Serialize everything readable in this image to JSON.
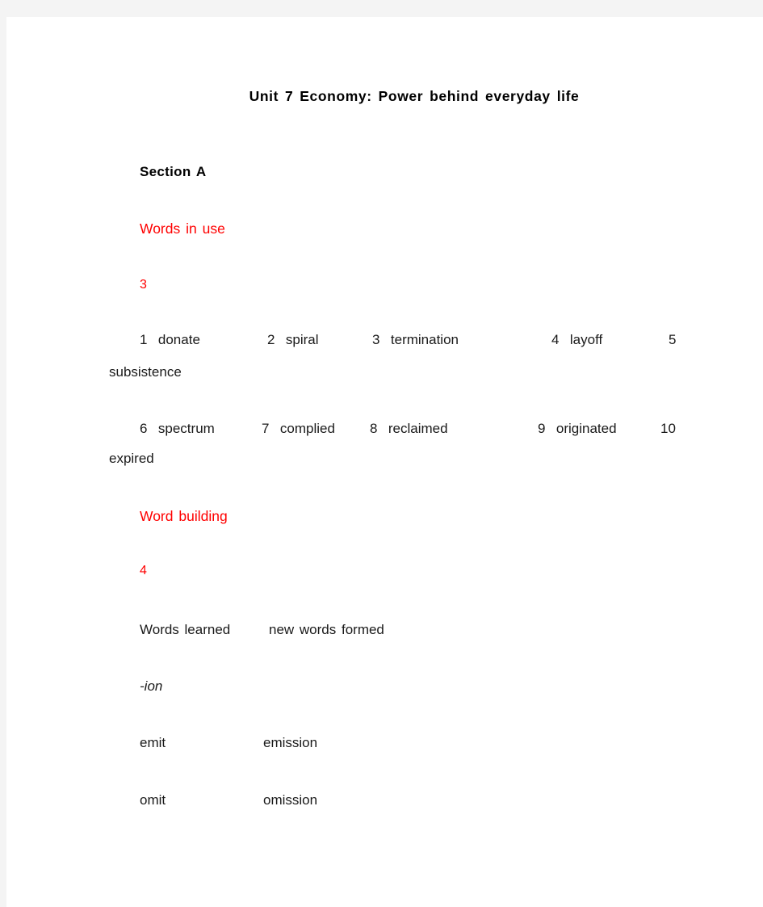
{
  "document": {
    "title": "Unit 7 Economy: Power behind everyday life",
    "section_heading": "Section A"
  },
  "words_in_use": {
    "heading": "Words in use",
    "exercise_number": "3",
    "answers": [
      {
        "number": "1",
        "word": "donate"
      },
      {
        "number": "2",
        "word": "spiral"
      },
      {
        "number": "3",
        "word": "termination"
      },
      {
        "number": "4",
        "word": "layoff"
      },
      {
        "number": "5",
        "word": "subsistence"
      },
      {
        "number": "6",
        "word": "spectrum"
      },
      {
        "number": "7",
        "word": "complied"
      },
      {
        "number": "8",
        "word": "reclaimed"
      },
      {
        "number": "9",
        "word": "originated"
      },
      {
        "number": "10",
        "word": "expired"
      }
    ],
    "row1": {
      "c1": "1  donate",
      "c2": "2  spiral",
      "c3": "3  termination",
      "c4": "4  layoff",
      "c5": "5",
      "wrapped": "subsistence"
    },
    "row2": {
      "c1": "6  spectrum",
      "c2": "7  complied",
      "c3": "8  reclaimed",
      "c4": "9  originated",
      "c5": "10",
      "wrapped": "expired"
    }
  },
  "word_building": {
    "heading": "Word building",
    "exercise_number": "4",
    "table": {
      "header_left": "Words learned",
      "header_right": "new words formed",
      "suffix": "-ion",
      "rows": [
        {
          "learned": "emit",
          "formed": "emission"
        },
        {
          "learned": "omit",
          "formed": "omission"
        }
      ]
    }
  },
  "colors": {
    "accent_red": "#ff0000",
    "text": "#1a1a1a",
    "page_background": "#ffffff",
    "canvas_background": "#f4f4f4"
  }
}
